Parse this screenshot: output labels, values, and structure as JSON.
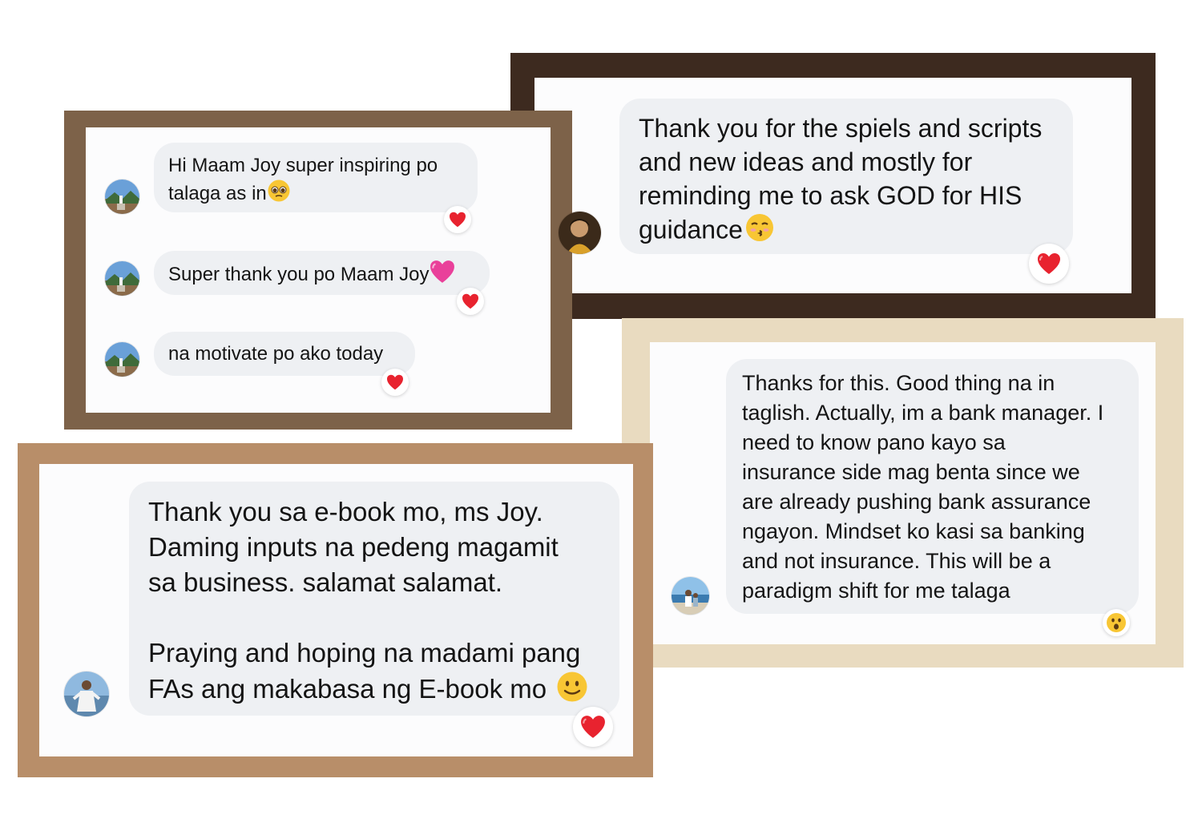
{
  "colors": {
    "card1_border": "#7d6249",
    "card2_border": "#3d2a1f",
    "card3_border": "#e9dbc0",
    "card4_border": "#b88e69",
    "bubble": "#eef0f3",
    "heart": "#e8232f"
  },
  "card_chat_1": {
    "messages": [
      {
        "text": "Hi Maam Joy super inspiring po\ntalaga as in",
        "emoji": "pleading-face-icon",
        "reaction": "heart-icon"
      },
      {
        "text": "Super thank you po Maam Joy",
        "emoji": "pink-heart-icon",
        "reaction": "heart-icon"
      },
      {
        "text": "na motivate po ako today",
        "reaction": "heart-icon"
      }
    ]
  },
  "card_chat_2": {
    "message": {
      "text": "Thank you for the spiels and scripts\nand new ideas and mostly for\nreminding me to ask GOD for HIS\nguidance",
      "emoji": "kissing-face-icon",
      "reaction": "heart-icon"
    }
  },
  "card_chat_3": {
    "message": {
      "text": "Thanks for this. Good thing na in\ntaglish. Actually, im a bank manager. I\nneed to know pano kayo sa\ninsurance side mag benta since we\nare already pushing bank assurance\nngayon. Mindset ko kasi sa banking\nand not insurance. This will be a\nparadigm shift for me talaga",
      "reaction": "surprised-face-icon"
    }
  },
  "card_chat_4": {
    "message": {
      "text": "Thank you sa e-book mo, ms Joy.\nDaming inputs na pedeng magamit\nsa business. salamat salamat.\n\nPraying and hoping na madami pang\nFAs ang makabasa ng E-book mo",
      "emoji": "slightly-smiling-face-icon",
      "reaction": "heart-icon"
    }
  }
}
